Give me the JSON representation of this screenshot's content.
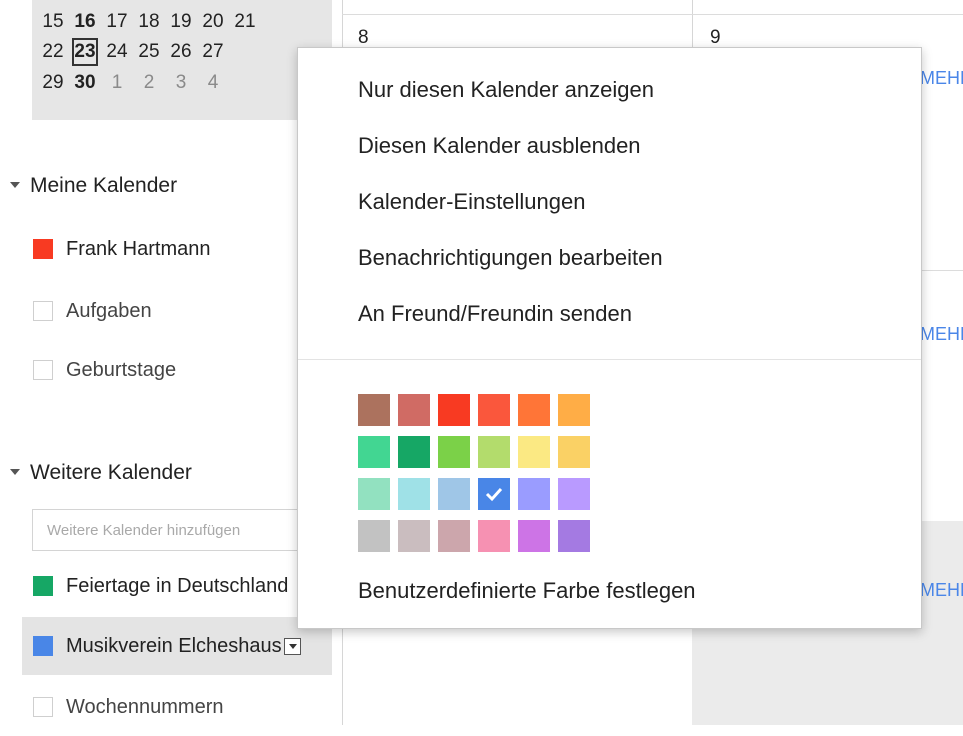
{
  "mini_calendar": {
    "weeks": [
      [
        {
          "d": "15",
          "t": ""
        },
        {
          "d": "16",
          "t": "bold"
        },
        {
          "d": "17",
          "t": ""
        },
        {
          "d": "18",
          "t": ""
        },
        {
          "d": "19",
          "t": ""
        },
        {
          "d": "20",
          "t": ""
        },
        {
          "d": "21",
          "t": ""
        }
      ],
      [
        {
          "d": "22",
          "t": ""
        },
        {
          "d": "23",
          "t": "today"
        },
        {
          "d": "24",
          "t": ""
        },
        {
          "d": "25",
          "t": ""
        },
        {
          "d": "26",
          "t": ""
        },
        {
          "d": "27",
          "t": ""
        },
        {
          "d": "",
          "t": ""
        }
      ],
      [
        {
          "d": "29",
          "t": ""
        },
        {
          "d": "30",
          "t": "bold"
        },
        {
          "d": "1",
          "t": "other"
        },
        {
          "d": "2",
          "t": "other"
        },
        {
          "d": "3",
          "t": "other"
        },
        {
          "d": "4",
          "t": "other"
        },
        {
          "d": "",
          "t": ""
        }
      ]
    ]
  },
  "sidebar": {
    "my_calendars_title": "Meine Kalender",
    "my_calendars": [
      {
        "label": "Frank Hartmann",
        "color": "#f83a22"
      },
      {
        "label": "Aufgaben",
        "color": ""
      },
      {
        "label": "Geburtstage",
        "color": ""
      }
    ],
    "other_calendars_title": "Weitere Kalender",
    "add_placeholder": "Weitere Kalender hinzufügen",
    "other_calendars": [
      {
        "label": "Feiertage in Deutschland",
        "color": "#16a765"
      },
      {
        "label": "Musikverein Elcheshausen",
        "color": "#4986e7"
      },
      {
        "label": "Wochennummern",
        "color": ""
      }
    ]
  },
  "grid": {
    "date_left": "8",
    "date_right": "9",
    "more_label": "MEHR"
  },
  "menu": {
    "items": [
      "Nur diesen Kalender anzeigen",
      "Diesen Kalender ausblenden",
      "Kalender-Einstellungen",
      "Benachrichtigungen bearbeiten",
      "An Freund/Freundin senden"
    ],
    "palette": [
      [
        "#ac725e",
        "#d06b64",
        "#f83a22",
        "#fa573c",
        "#ff7537",
        "#ffad46"
      ],
      [
        "#42d692",
        "#16a765",
        "#7bd148",
        "#b3dc6c",
        "#fbe983",
        "#fad165"
      ],
      [
        "#92e1c0",
        "#9fe1e7",
        "#9fc6e7",
        "#4986e7",
        "#9a9cff",
        "#b99aff"
      ],
      [
        "#c2c2c2",
        "#cabdbf",
        "#cca6ac",
        "#f691b2",
        "#cd74e6",
        "#a47ae2"
      ]
    ],
    "selected_color": "#4986e7",
    "custom_color_label": "Benutzerdefinierte Farbe festlegen"
  }
}
